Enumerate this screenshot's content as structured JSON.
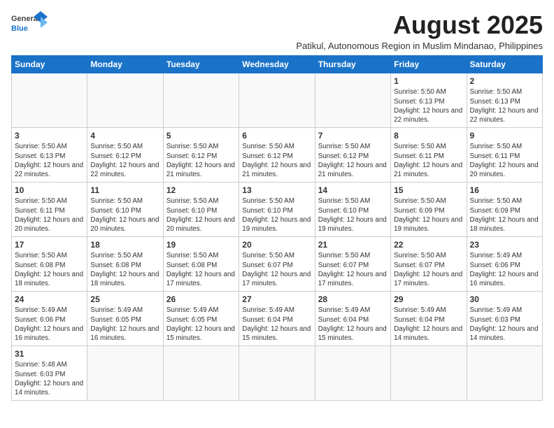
{
  "logo": {
    "text_general": "General",
    "text_blue": "Blue"
  },
  "title": "August 2025",
  "subtitle": "Patikul, Autonomous Region in Muslim Mindanao, Philippines",
  "days_of_week": [
    "Sunday",
    "Monday",
    "Tuesday",
    "Wednesday",
    "Thursday",
    "Friday",
    "Saturday"
  ],
  "weeks": [
    [
      {
        "day": "",
        "info": ""
      },
      {
        "day": "",
        "info": ""
      },
      {
        "day": "",
        "info": ""
      },
      {
        "day": "",
        "info": ""
      },
      {
        "day": "",
        "info": ""
      },
      {
        "day": "1",
        "info": "Sunrise: 5:50 AM\nSunset: 6:13 PM\nDaylight: 12 hours\nand 22 minutes."
      },
      {
        "day": "2",
        "info": "Sunrise: 5:50 AM\nSunset: 6:13 PM\nDaylight: 12 hours\nand 22 minutes."
      }
    ],
    [
      {
        "day": "3",
        "info": "Sunrise: 5:50 AM\nSunset: 6:13 PM\nDaylight: 12 hours\nand 22 minutes."
      },
      {
        "day": "4",
        "info": "Sunrise: 5:50 AM\nSunset: 6:12 PM\nDaylight: 12 hours\nand 22 minutes."
      },
      {
        "day": "5",
        "info": "Sunrise: 5:50 AM\nSunset: 6:12 PM\nDaylight: 12 hours\nand 21 minutes."
      },
      {
        "day": "6",
        "info": "Sunrise: 5:50 AM\nSunset: 6:12 PM\nDaylight: 12 hours\nand 21 minutes."
      },
      {
        "day": "7",
        "info": "Sunrise: 5:50 AM\nSunset: 6:12 PM\nDaylight: 12 hours\nand 21 minutes."
      },
      {
        "day": "8",
        "info": "Sunrise: 5:50 AM\nSunset: 6:11 PM\nDaylight: 12 hours\nand 21 minutes."
      },
      {
        "day": "9",
        "info": "Sunrise: 5:50 AM\nSunset: 6:11 PM\nDaylight: 12 hours\nand 20 minutes."
      }
    ],
    [
      {
        "day": "10",
        "info": "Sunrise: 5:50 AM\nSunset: 6:11 PM\nDaylight: 12 hours\nand 20 minutes."
      },
      {
        "day": "11",
        "info": "Sunrise: 5:50 AM\nSunset: 6:10 PM\nDaylight: 12 hours\nand 20 minutes."
      },
      {
        "day": "12",
        "info": "Sunrise: 5:50 AM\nSunset: 6:10 PM\nDaylight: 12 hours\nand 20 minutes."
      },
      {
        "day": "13",
        "info": "Sunrise: 5:50 AM\nSunset: 6:10 PM\nDaylight: 12 hours\nand 19 minutes."
      },
      {
        "day": "14",
        "info": "Sunrise: 5:50 AM\nSunset: 6:10 PM\nDaylight: 12 hours\nand 19 minutes."
      },
      {
        "day": "15",
        "info": "Sunrise: 5:50 AM\nSunset: 6:09 PM\nDaylight: 12 hours\nand 19 minutes."
      },
      {
        "day": "16",
        "info": "Sunrise: 5:50 AM\nSunset: 6:09 PM\nDaylight: 12 hours\nand 18 minutes."
      }
    ],
    [
      {
        "day": "17",
        "info": "Sunrise: 5:50 AM\nSunset: 6:08 PM\nDaylight: 12 hours\nand 18 minutes."
      },
      {
        "day": "18",
        "info": "Sunrise: 5:50 AM\nSunset: 6:08 PM\nDaylight: 12 hours\nand 18 minutes."
      },
      {
        "day": "19",
        "info": "Sunrise: 5:50 AM\nSunset: 6:08 PM\nDaylight: 12 hours\nand 17 minutes."
      },
      {
        "day": "20",
        "info": "Sunrise: 5:50 AM\nSunset: 6:07 PM\nDaylight: 12 hours\nand 17 minutes."
      },
      {
        "day": "21",
        "info": "Sunrise: 5:50 AM\nSunset: 6:07 PM\nDaylight: 12 hours\nand 17 minutes."
      },
      {
        "day": "22",
        "info": "Sunrise: 5:50 AM\nSunset: 6:07 PM\nDaylight: 12 hours\nand 17 minutes."
      },
      {
        "day": "23",
        "info": "Sunrise: 5:49 AM\nSunset: 6:06 PM\nDaylight: 12 hours\nand 16 minutes."
      }
    ],
    [
      {
        "day": "24",
        "info": "Sunrise: 5:49 AM\nSunset: 6:06 PM\nDaylight: 12 hours\nand 16 minutes."
      },
      {
        "day": "25",
        "info": "Sunrise: 5:49 AM\nSunset: 6:05 PM\nDaylight: 12 hours\nand 16 minutes."
      },
      {
        "day": "26",
        "info": "Sunrise: 5:49 AM\nSunset: 6:05 PM\nDaylight: 12 hours\nand 15 minutes."
      },
      {
        "day": "27",
        "info": "Sunrise: 5:49 AM\nSunset: 6:04 PM\nDaylight: 12 hours\nand 15 minutes."
      },
      {
        "day": "28",
        "info": "Sunrise: 5:49 AM\nSunset: 6:04 PM\nDaylight: 12 hours\nand 15 minutes."
      },
      {
        "day": "29",
        "info": "Sunrise: 5:49 AM\nSunset: 6:04 PM\nDaylight: 12 hours\nand 14 minutes."
      },
      {
        "day": "30",
        "info": "Sunrise: 5:49 AM\nSunset: 6:03 PM\nDaylight: 12 hours\nand 14 minutes."
      }
    ],
    [
      {
        "day": "31",
        "info": "Sunrise: 5:48 AM\nSunset: 6:03 PM\nDaylight: 12 hours\nand 14 minutes."
      },
      {
        "day": "",
        "info": ""
      },
      {
        "day": "",
        "info": ""
      },
      {
        "day": "",
        "info": ""
      },
      {
        "day": "",
        "info": ""
      },
      {
        "day": "",
        "info": ""
      },
      {
        "day": "",
        "info": ""
      }
    ]
  ]
}
